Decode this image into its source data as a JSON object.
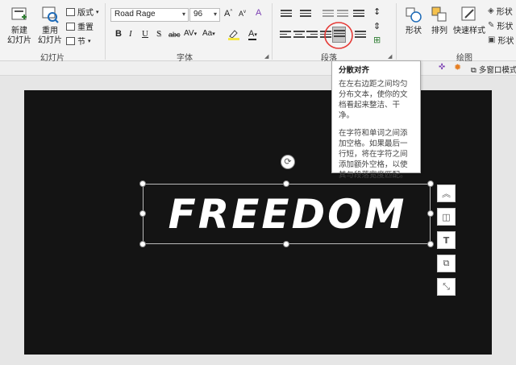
{
  "ribbon": {
    "slides_group": {
      "label": "幻灯片",
      "new_slide": "新建\n幻灯片",
      "reuse_slide": "重用\n幻灯片",
      "layout": "版式",
      "reset": "重置",
      "section": "节"
    },
    "font_group": {
      "label": "字体",
      "font_name": "Road Rage",
      "font_size": "96",
      "bold": "B",
      "italic": "I",
      "underline": "U",
      "shadow": "S",
      "strike": "abc",
      "spacing": "AV",
      "case": "Aa",
      "grow": "A",
      "shrink": "A"
    },
    "paragraph_group": {
      "label": "段落"
    },
    "drawing_group": {
      "label": "绘图",
      "shapes": "形状",
      "arrange": "排列",
      "quick_styles": "快速样式",
      "fill": "形状",
      "outline": "形状",
      "effects": "形状"
    },
    "accent_circle_color": "#e53935"
  },
  "statusbar": {
    "multi_window": "多窗口模式"
  },
  "tooltip": {
    "title": "分散对齐",
    "para1": "在左右边距之间均匀分布文本，使你的文档看起来整洁、干净。",
    "para2": "在字符和单词之间添加空格。如果最后一行短，将在字符之间添加额外空格，以使其与段落宽度匹配。"
  },
  "slide": {
    "text": "FREEDOM",
    "background": "#141414"
  },
  "side_tools": [
    "layout-options",
    "position",
    "text-box",
    "arrange",
    "crop"
  ]
}
